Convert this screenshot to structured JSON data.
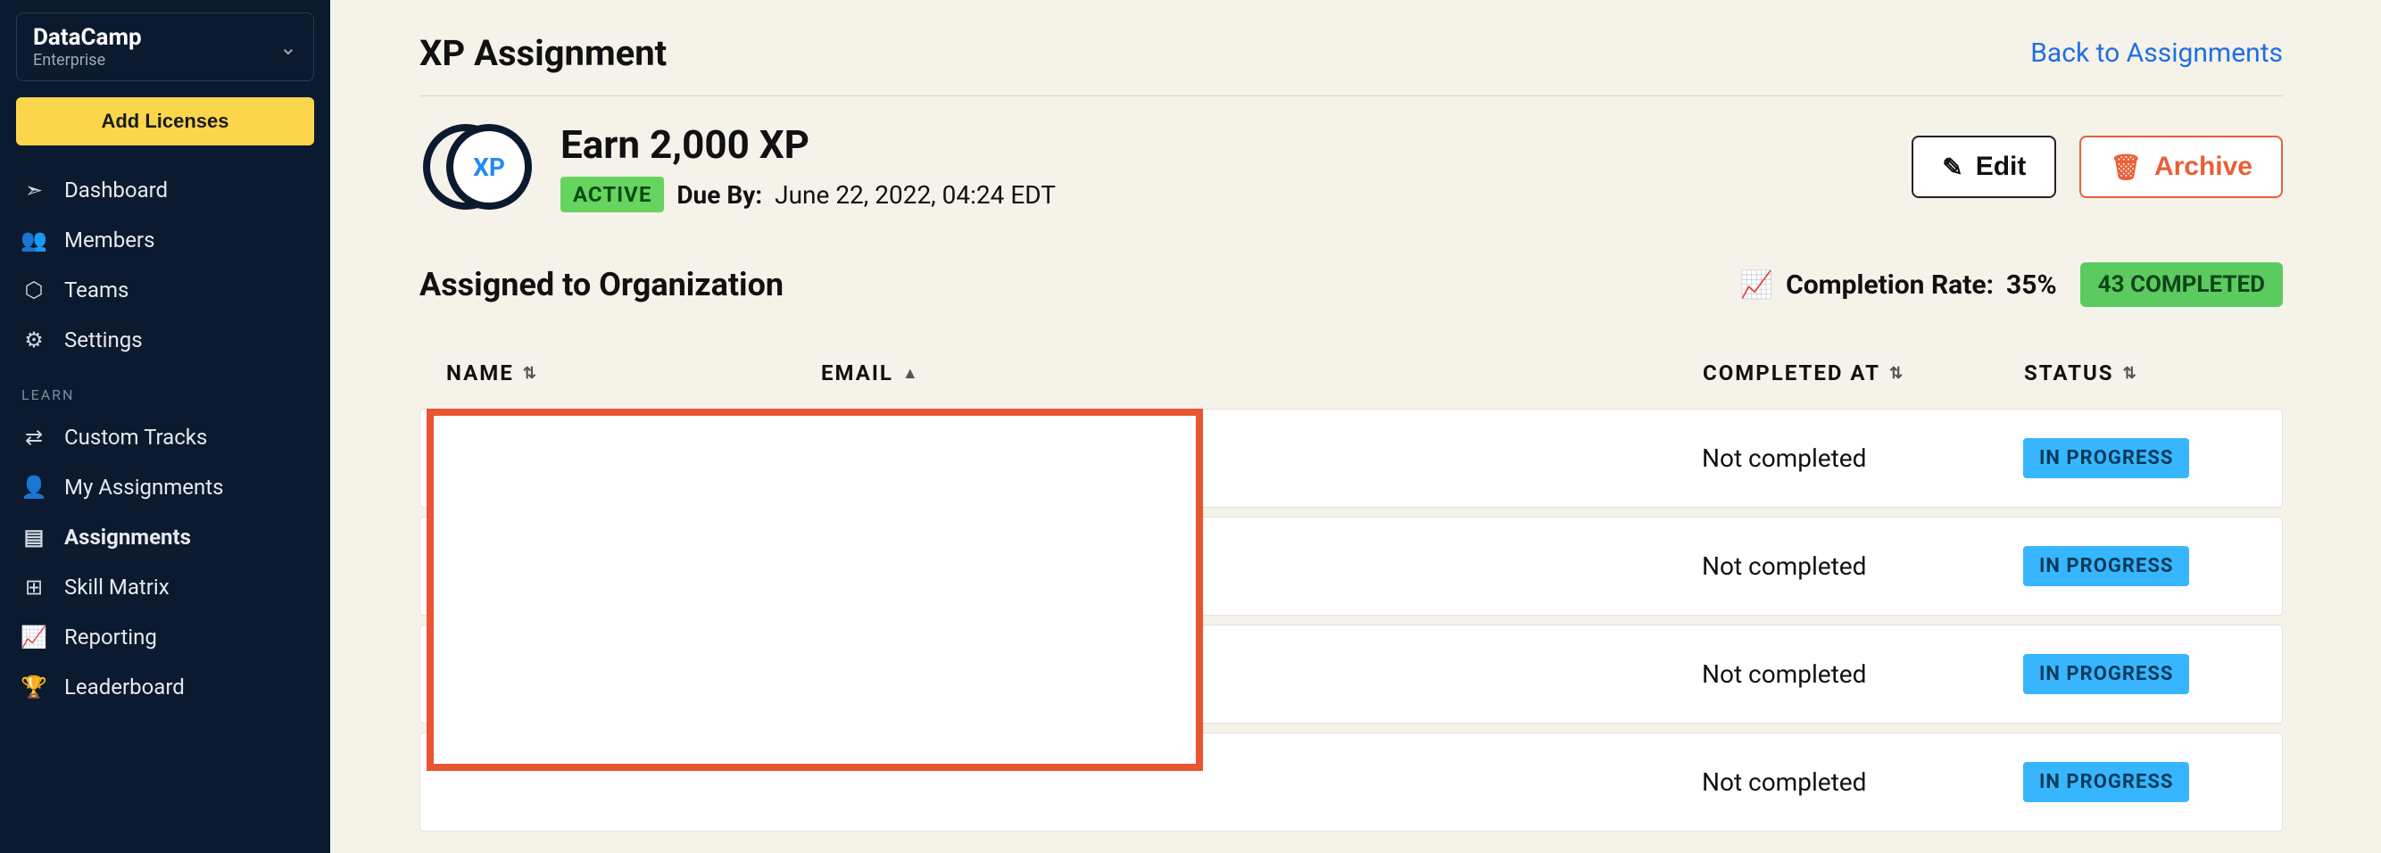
{
  "org": {
    "name": "DataCamp",
    "plan": "Enterprise"
  },
  "sidebar": {
    "add_licenses": "Add Licenses",
    "section_learn": "LEARN",
    "items_main": [
      {
        "label": "Dashboard",
        "icon": "➣"
      },
      {
        "label": "Members",
        "icon": "👥"
      },
      {
        "label": "Teams",
        "icon": "⬡"
      },
      {
        "label": "Settings",
        "icon": "⚙"
      }
    ],
    "items_learn": [
      {
        "label": "Custom Tracks",
        "icon": "⇄"
      },
      {
        "label": "My Assignments",
        "icon": "👤"
      },
      {
        "label": "Assignments",
        "icon": "▤",
        "active": true
      },
      {
        "label": "Skill Matrix",
        "icon": "⊞"
      },
      {
        "label": "Reporting",
        "icon": "📈"
      },
      {
        "label": "Leaderboard",
        "icon": "🏆"
      }
    ]
  },
  "header": {
    "page_title": "XP Assignment",
    "back_link": "Back to Assignments"
  },
  "assignment": {
    "title": "Earn 2,000 XP",
    "status_pill": "ACTIVE",
    "due_label": "Due By:",
    "due_value": "June 22, 2022, 04:24 EDT",
    "edit_label": "Edit",
    "archive_label": "Archive"
  },
  "section": {
    "title": "Assigned to Organization",
    "completion_label": "Completion Rate:",
    "completion_value": "35%",
    "completed_pill": "43 COMPLETED"
  },
  "table": {
    "columns": {
      "name": "NAME",
      "email": "EMAIL",
      "completed_at": "COMPLETED AT",
      "status": "STATUS"
    },
    "rows": [
      {
        "name": "",
        "email": "",
        "completed_at": "Not completed",
        "status": "IN PROGRESS"
      },
      {
        "name": "",
        "email": "",
        "completed_at": "Not completed",
        "status": "IN PROGRESS"
      },
      {
        "name": "",
        "email": "",
        "completed_at": "Not completed",
        "status": "IN PROGRESS"
      },
      {
        "name": "",
        "email": "",
        "completed_at": "Not completed",
        "status": "IN PROGRESS"
      }
    ]
  }
}
